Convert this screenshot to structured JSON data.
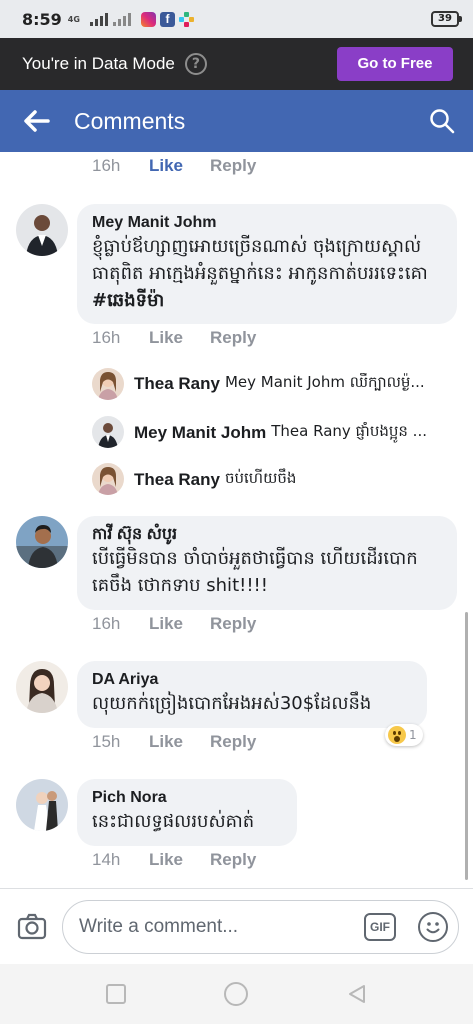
{
  "status_bar": {
    "time": "8:59",
    "network": "4G",
    "battery": "39"
  },
  "data_mode": {
    "message": "You're in Data Mode",
    "help": "?",
    "cta": "Go to Free"
  },
  "header": {
    "title": "Comments"
  },
  "colors": {
    "brand": "#4267b2",
    "cta": "#8a3ec7",
    "meta": "#90949c"
  },
  "comments": [
    {
      "author": "",
      "text": "",
      "time": "16h",
      "like": "Like",
      "reply": "Reply"
    },
    {
      "author": "Mey Manit Johm",
      "text": "ខ្ញុំធ្លាប់ឪហ្សាញអោយច្រើនណាស់ ចុងក្រោយស្គាល់ធាតុពិត អាក្មេងអំនួតម្នាក់នេះ អាកូនកាត់បររទេះគោ",
      "tag": "#ឆេងទីម៉ា",
      "time": "16h",
      "like": "Like",
      "reply": "Reply"
    },
    {
      "author": "កាវី ស៊ុន សំបូរ",
      "text": "បើធ្វើមិនបាន ចាំបាច់អួតថាធ្វើបាន ហើយដើរបោកគេចឹង ថោកទាប shit!!!!",
      "time": "16h",
      "like": "Like",
      "reply": "Reply"
    },
    {
      "author": "DA Ariya",
      "text": "លុយកក់ច្រៀងបោកអែងអស់30$ដែលនឹង",
      "time": "15h",
      "like": "Like",
      "reply": "Reply",
      "reaction_count": "1"
    },
    {
      "author": "Pich Nora",
      "text": "នេះជាលទ្ធផលរបស់គាត់",
      "time": "14h",
      "like": "Like",
      "reply": "Reply"
    }
  ],
  "replies": [
    {
      "author": "Thea Rany",
      "text": "Mey Manit Johm ឈឺក្បាលម៉្ង..."
    },
    {
      "author": "Mey Manit Johm",
      "text": "Thea Rany ផ្ញាំបងប្អូន ..."
    },
    {
      "author": "Thea Rany",
      "text": "ចប់ហើយចឹង"
    }
  ],
  "composer": {
    "placeholder": "Write a comment...",
    "gif": "GIF"
  }
}
